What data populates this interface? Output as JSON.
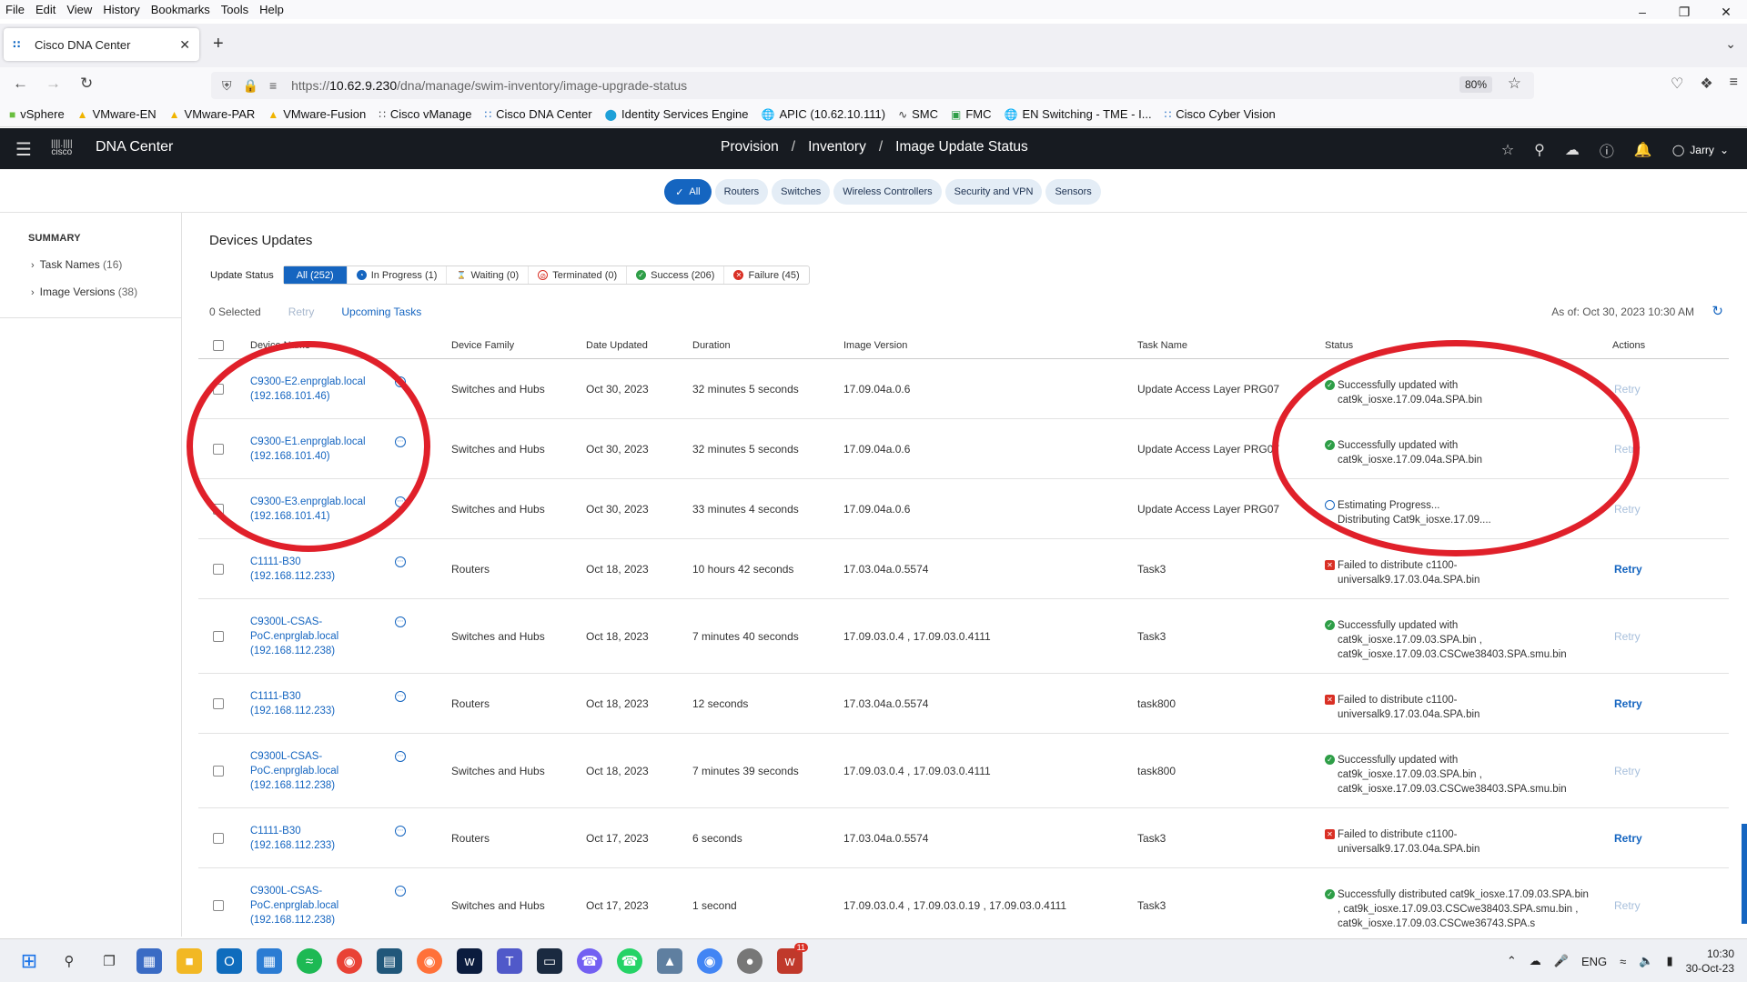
{
  "browser": {
    "menu": [
      "File",
      "Edit",
      "View",
      "History",
      "Bookmarks",
      "Tools",
      "Help"
    ],
    "tab_title": "Cisco DNA Center",
    "url_prefix": "https://",
    "url_host": "10.62.9.230",
    "url_path": "/dna/manage/swim-inventory/image-upgrade-status",
    "zoom": "80%",
    "bookmarks": [
      "vSphere",
      "VMware-EN",
      "VMware-PAR",
      "VMware-Fusion",
      "Cisco vManage",
      "Cisco DNA Center",
      "Identity Services Engine",
      "APIC (10.62.10.111)",
      "SMC",
      "FMC",
      "EN Switching - TME - I...",
      "Cisco Cyber Vision"
    ]
  },
  "header": {
    "app_title": "DNA Center",
    "breadcrumb": [
      "Provision",
      "Inventory",
      "Image Update Status"
    ],
    "user": "Jarry"
  },
  "filters": [
    "All",
    "Routers",
    "Switches",
    "Wireless Controllers",
    "Security and VPN",
    "Sensors"
  ],
  "summary": {
    "title": "SUMMARY",
    "items": [
      {
        "label": "Task Names",
        "count": "(16)"
      },
      {
        "label": "Image Versions",
        "count": "(38)"
      }
    ]
  },
  "main": {
    "title": "Devices Updates",
    "status_label": "Update Status",
    "status_tabs": [
      "All (252)",
      "In Progress (1)",
      "Waiting (0)",
      "Terminated (0)",
      "Success (206)",
      "Failure (45)"
    ],
    "selected": "0 Selected",
    "retry": "Retry",
    "upcoming": "Upcoming Tasks",
    "as_of": "As of: Oct 30, 2023 10:30 AM"
  },
  "columns": [
    "Device Name",
    "Device Family",
    "Date Updated",
    "Duration",
    "Image Version",
    "Task Name",
    "Status",
    "Actions"
  ],
  "rows": [
    {
      "device": "C9300-E2.enprglab.local (192.168.101.46)",
      "family": "Switches and Hubs",
      "date": "Oct 30, 2023",
      "duration": "32 minutes 5 seconds",
      "image": "17.09.04a.0.6",
      "task": "Update Access Layer PRG07",
      "status_type": "ok",
      "status": "Successfully updated with cat9k_iosxe.17.09.04a.SPA.bin",
      "action": "Retry",
      "action_enabled": false
    },
    {
      "device": "C9300-E1.enprglab.local (192.168.101.40)",
      "family": "Switches and Hubs",
      "date": "Oct 30, 2023",
      "duration": "32 minutes 5 seconds",
      "image": "17.09.04a.0.6",
      "task": "Update Access Layer PRG07",
      "status_type": "ok",
      "status": "Successfully updated with cat9k_iosxe.17.09.04a.SPA.bin",
      "action": "Retry",
      "action_enabled": false
    },
    {
      "device": "C9300-E3.enprglab.local (192.168.101.41)",
      "family": "Switches and Hubs",
      "date": "Oct 30, 2023",
      "duration": "33 minutes 4 seconds",
      "image": "17.09.04a.0.6",
      "task": "Update Access Layer PRG07",
      "status_type": "prog",
      "status": "Estimating Progress...",
      "status2": "Distributing Cat9k_iosxe.17.09....",
      "action": "Retry",
      "action_enabled": false
    },
    {
      "device": "C1111-B30 (192.168.112.233)",
      "family": "Routers",
      "date": "Oct 18, 2023",
      "duration": "10 hours 42 seconds",
      "image": "17.03.04a.0.5574",
      "task": "Task3",
      "status_type": "fail",
      "status": "Failed to distribute c1100-universalk9.17.03.04a.SPA.bin",
      "action": "Retry",
      "action_enabled": true
    },
    {
      "device": "C9300L-CSAS-PoC.enprglab.local (192.168.112.238)",
      "family": "Switches and Hubs",
      "date": "Oct 18, 2023",
      "duration": "7 minutes 40 seconds",
      "image": "17.09.03.0.4 , 17.09.03.0.4111",
      "task": "Task3",
      "status_type": "ok",
      "status": "Successfully updated with cat9k_iosxe.17.09.03.SPA.bin , cat9k_iosxe.17.09.03.CSCwe38403.SPA.smu.bin",
      "action": "Retry",
      "action_enabled": false
    },
    {
      "device": "C1111-B30 (192.168.112.233)",
      "family": "Routers",
      "date": "Oct 18, 2023",
      "duration": "12 seconds",
      "image": "17.03.04a.0.5574",
      "task": "task800",
      "status_type": "fail",
      "status": "Failed to distribute c1100-universalk9.17.03.04a.SPA.bin",
      "action": "Retry",
      "action_enabled": true
    },
    {
      "device": "C9300L-CSAS-PoC.enprglab.local (192.168.112.238)",
      "family": "Switches and Hubs",
      "date": "Oct 18, 2023",
      "duration": "7 minutes 39 seconds",
      "image": "17.09.03.0.4 , 17.09.03.0.4111",
      "task": "task800",
      "status_type": "ok",
      "status": "Successfully updated with cat9k_iosxe.17.09.03.SPA.bin , cat9k_iosxe.17.09.03.CSCwe38403.SPA.smu.bin",
      "action": "Retry",
      "action_enabled": false
    },
    {
      "device": "C1111-B30 (192.168.112.233)",
      "family": "Routers",
      "date": "Oct 17, 2023",
      "duration": "6 seconds",
      "image": "17.03.04a.0.5574",
      "task": "Task3",
      "status_type": "fail",
      "status": "Failed to distribute c1100-universalk9.17.03.04a.SPA.bin",
      "action": "Retry",
      "action_enabled": true
    },
    {
      "device": "C9300L-CSAS-PoC.enprglab.local (192.168.112.238)",
      "family": "Switches and Hubs",
      "date": "Oct 17, 2023",
      "duration": "1 second",
      "image": "17.09.03.0.4 , 17.09.03.0.19 , 17.09.03.0.4111",
      "task": "Task3",
      "status_type": "ok",
      "status": "Successfully distributed cat9k_iosxe.17.09.03.SPA.bin , cat9k_iosxe.17.09.03.CSCwe38403.SPA.smu.bin , cat9k_iosxe.17.09.03.CSCwe36743.SPA.s",
      "action": "Retry",
      "action_enabled": false
    }
  ],
  "taskbar": {
    "lang": "ENG",
    "time": "10:30",
    "date": "30-Oct-23",
    "notif_badge": "11"
  },
  "colors": {
    "accent": "#1565c0",
    "header_bg": "#171b21",
    "success": "#2e9e47",
    "failure": "#d93025",
    "annotation": "#e0202a"
  }
}
